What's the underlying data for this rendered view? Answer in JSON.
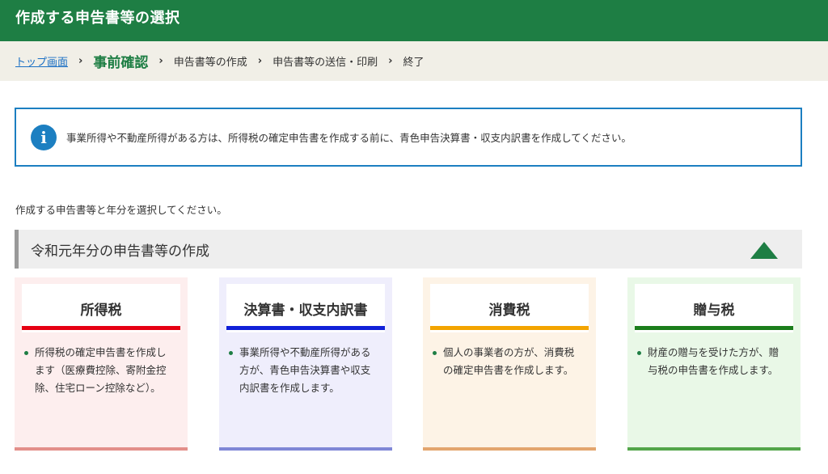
{
  "header": {
    "title": "作成する申告書等の選択"
  },
  "breadcrumb": {
    "home": "トップ画面",
    "current": "事前確認",
    "steps": [
      "申告書等の作成",
      "申告書等の送信・印刷",
      "終了"
    ],
    "separator": "›"
  },
  "info": {
    "icon": "info-icon",
    "glyph": "i",
    "text": "事業所得や不動産所得がある方は、所得税の確定申告書を作成する前に、青色申告決算書・収支内訳書を作成してください。"
  },
  "instruction": "作成する申告書等と年分を選択してください。",
  "section": {
    "title": "令和元年分の申告書等の作成",
    "toggle_icon": "triangle-up-icon"
  },
  "cards": [
    {
      "title": "所得税",
      "description": "所得税の確定申告書を作成します（医療費控除、寄附金控除、住宅ローン控除など）。",
      "bg": "#fdeeee",
      "accent": "#e60012",
      "bottom": "#e38f8a"
    },
    {
      "title": "決算書・収支内訳書",
      "description": "事業所得や不動産所得がある方が、青色申告決算書や収支内訳書を作成します。",
      "bg": "#efeefc",
      "accent": "#1020d8",
      "bottom": "#7f87d6"
    },
    {
      "title": "消費税",
      "description": "個人の事業者の方が、消費税の確定申告書を作成します。",
      "bg": "#fdf3e6",
      "accent": "#f3a400",
      "bottom": "#e3a56e"
    },
    {
      "title": "贈与税",
      "description": "財産の贈与を受けた方が、贈与税の申告書を作成します。",
      "bg": "#e9f8e7",
      "accent": "#1b7d1b",
      "bottom": "#53a54a"
    }
  ]
}
